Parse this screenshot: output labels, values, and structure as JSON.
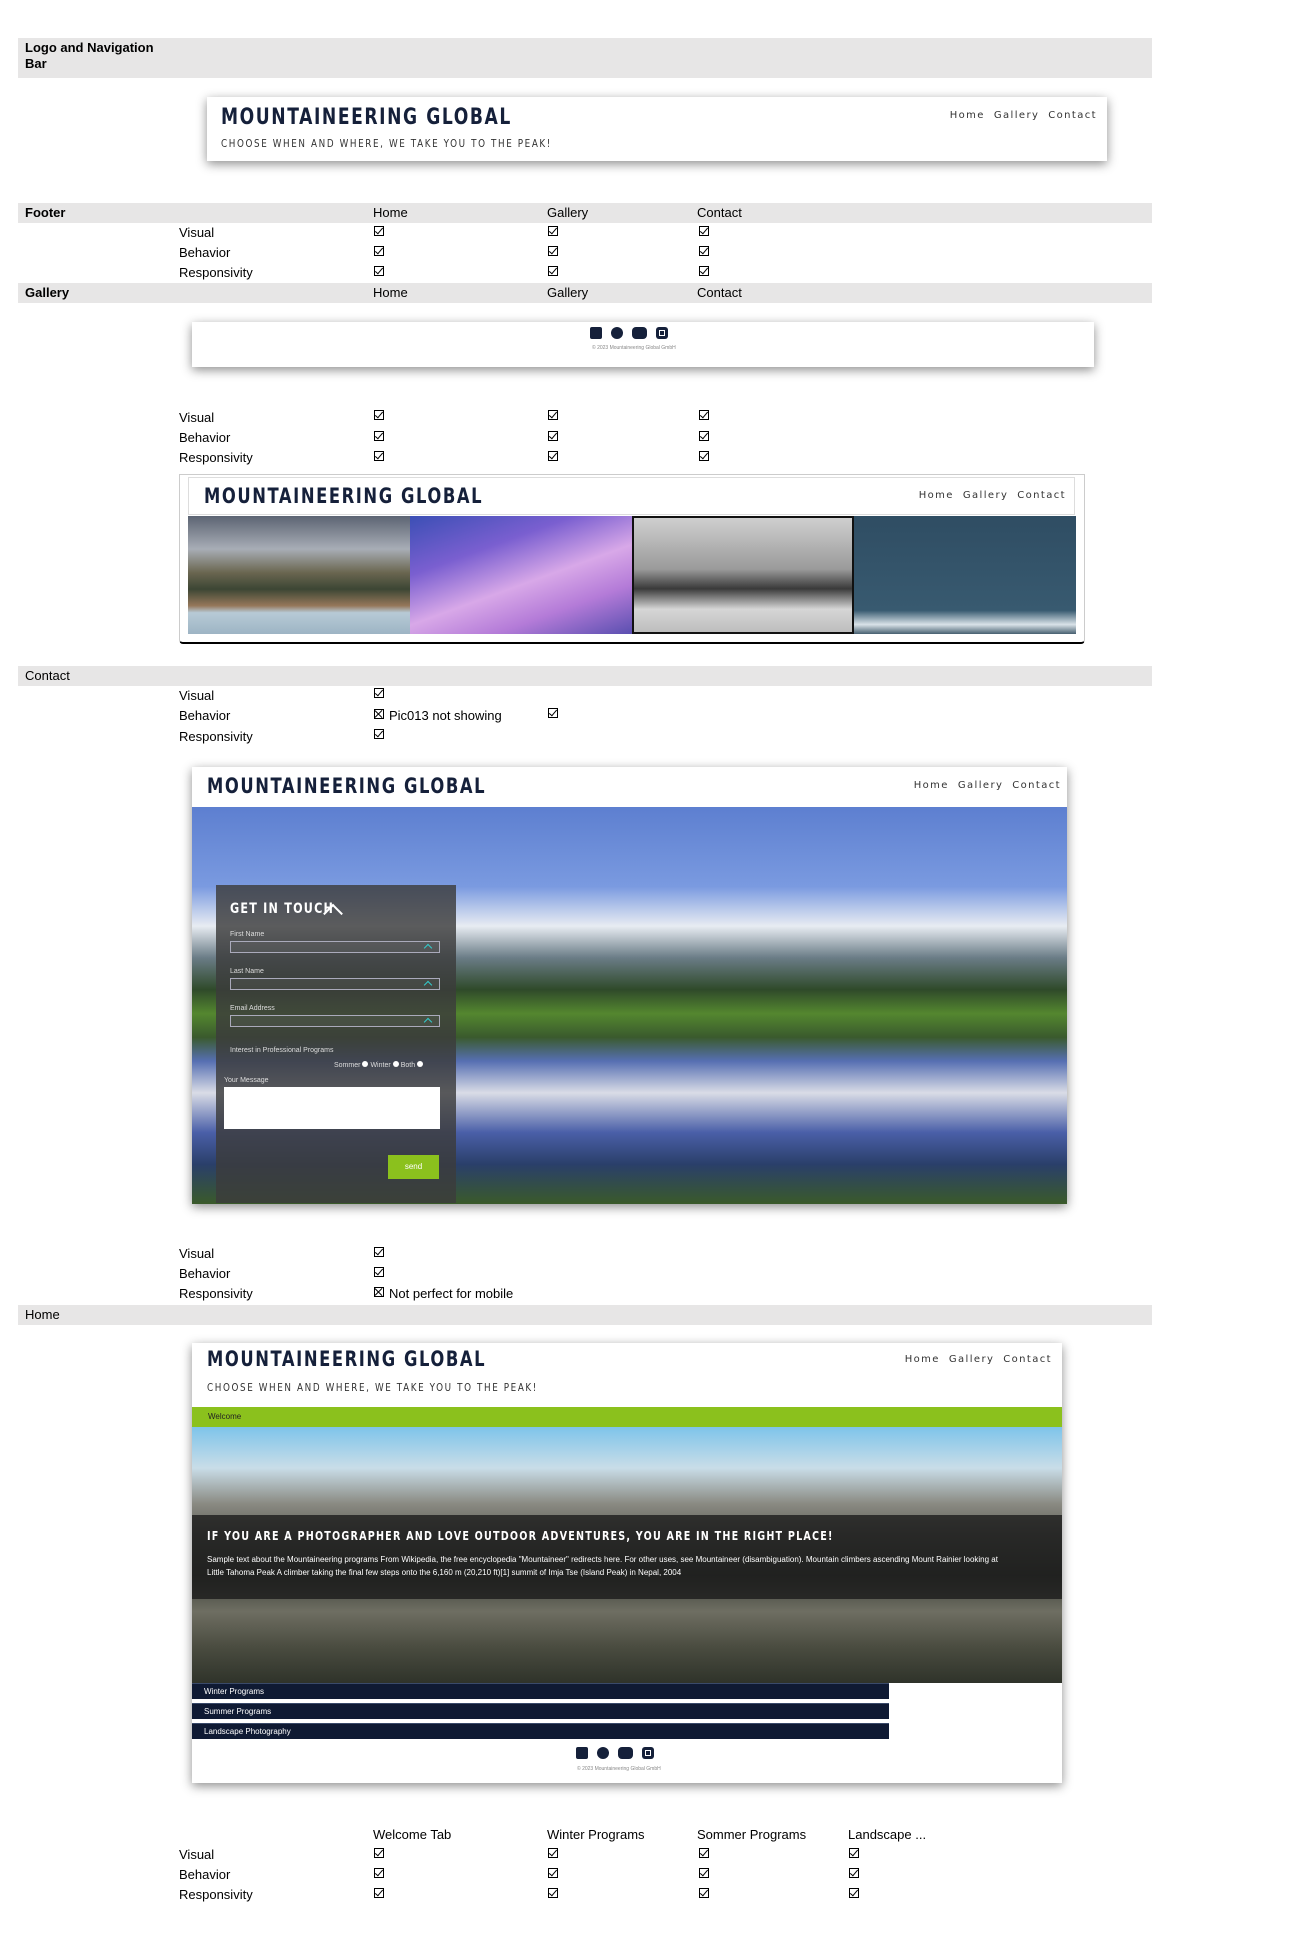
{
  "sections": {
    "logo_nav": "Logo and Navigation Bar",
    "footer": "Footer",
    "gallery": "Gallery",
    "contact": "Contact",
    "home": "Home"
  },
  "columns": {
    "home": "Home",
    "gallery": "Gallery",
    "contact": "Contact"
  },
  "home_columns": {
    "welcome": "Welcome Tab",
    "winter": "Winter Programs",
    "sommer": "Sommer Programs",
    "landscape": "Landscape ..."
  },
  "criteria": {
    "visual": "Visual",
    "behavior": "Behavior",
    "responsivity": "Responsivity"
  },
  "notes": {
    "pic_issue": "Pic013 not showing",
    "mobile_issue": "Not perfect for mobile"
  },
  "site": {
    "brand": "MOUNTAINEERING GLOBAL",
    "tagline": "CHOOSE WHEN AND WHERE, WE TAKE YOU TO THE PEAK!",
    "nav": [
      "Home",
      "Gallery",
      "Contact"
    ],
    "copyright": "© 2023 Mountaineering Global GmbH",
    "footer_icons": [
      "facebook-icon",
      "twitter-icon",
      "youtube-icon",
      "instagram-icon"
    ]
  },
  "contact_form": {
    "title": "GET IN TOUCH",
    "first_name": "First Name",
    "last_name": "Last Name",
    "email": "Email Address",
    "interest": "Interest in Professional Programs",
    "options": [
      "Sommer",
      "Winter",
      "Both"
    ],
    "message": "Your Message",
    "send": "send"
  },
  "home_page": {
    "welcome_tab": "Welcome",
    "headline": "IF YOU ARE A PHOTOGRAPHER AND LOVE OUTDOOR ADVENTURES, YOU ARE IN THE RIGHT PLACE!",
    "body": "Sample text about the Mountaineering programs From Wikipedia, the free encyclopedia \"Mountaineer\" redirects here. For other uses, see Mountaineer (disambiguation). Mountain climbers ascending Mount Rainier looking at Little Tahoma Peak A climber taking the final few steps onto the 6,160 m (20,210 ft)[1] summit of Imja Tse (Island Peak) in Nepal, 2004",
    "menu": [
      "Winter Programs",
      "Summer Programs",
      "Landscape Photography"
    ]
  },
  "colors": {
    "band": "#e7e6e6",
    "brand": "#15203a",
    "accent": "#8bc11d",
    "menu_bg": "#0f1a33"
  }
}
